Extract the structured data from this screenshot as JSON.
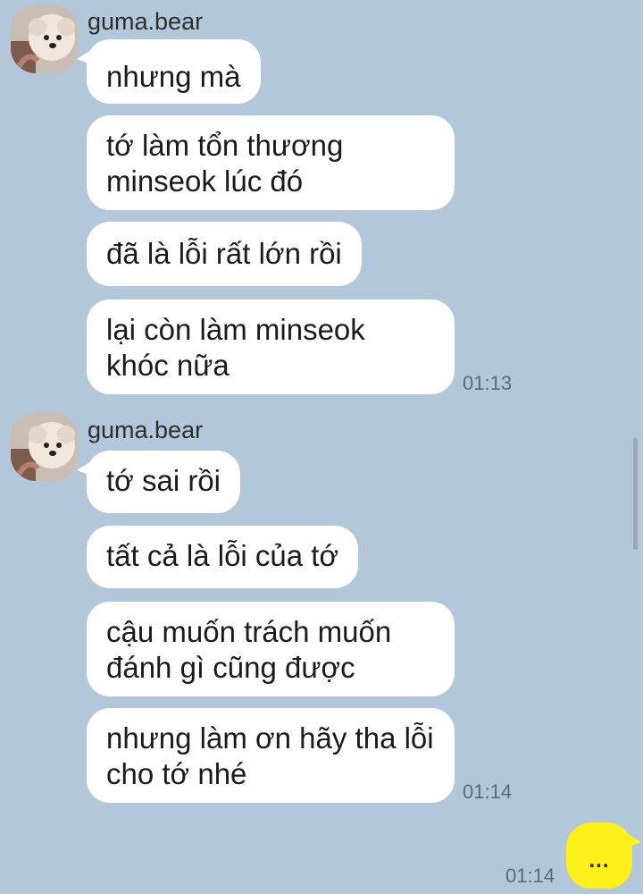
{
  "colors": {
    "background": "#b2c7da",
    "incoming_bubble": "#ffffff",
    "outgoing_bubble": "#fef01b"
  },
  "groups": [
    {
      "sender": "guma.bear",
      "avatar_icon": "pomeranian-dog-avatar",
      "messages": [
        "nhưng mà",
        "tớ làm tổn thương\nminseok lúc đó",
        "đã là lỗi rất lớn rồi",
        "lại còn làm minseok\nkhóc nữa"
      ],
      "time": "01:13"
    },
    {
      "sender": "guma.bear",
      "avatar_icon": "pomeranian-dog-avatar",
      "messages": [
        "tớ sai rồi",
        "tất cả là lỗi của tớ",
        "cậu muốn trách muốn\nđánh gì cũng được",
        "nhưng làm ơn hãy tha lỗi\ncho tớ nhé"
      ],
      "time": "01:14"
    }
  ],
  "outgoing": {
    "text": "...",
    "time": "01:14"
  }
}
